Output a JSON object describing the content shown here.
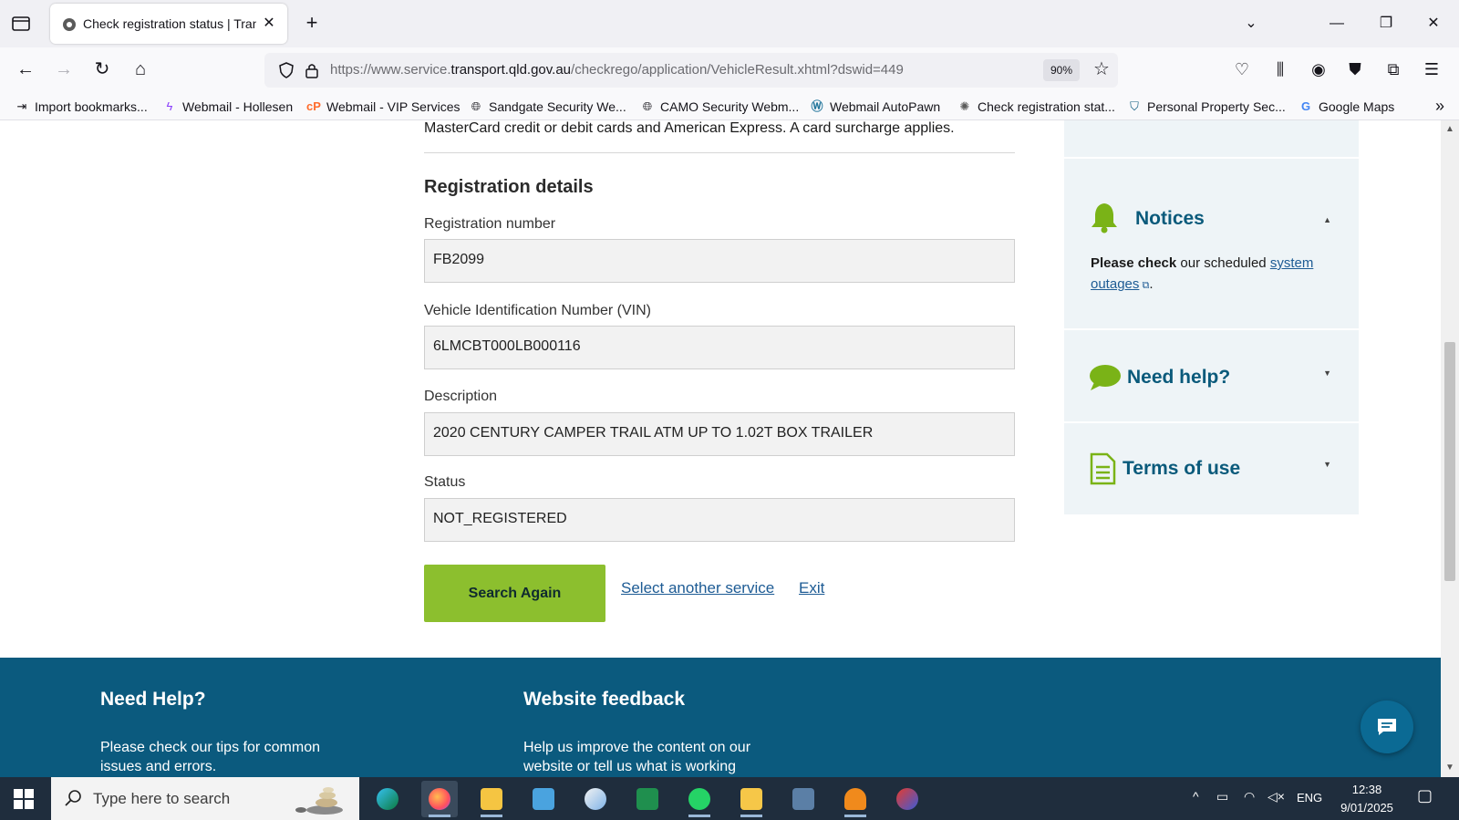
{
  "browser": {
    "tab_title": "Check registration status | Trans",
    "url_prefix": "https://www.service.",
    "url_domain": "transport.qld.gov.au",
    "url_path": "/checkrego/application/VehicleResult.xhtml?dswid=449",
    "zoom": "90%",
    "bookmarks": [
      {
        "label": "Import bookmarks...",
        "icon": "import-icon"
      },
      {
        "label": "Webmail - Hollesen",
        "icon": "lightning-icon"
      },
      {
        "label": "Webmail - VIP Services",
        "icon": "cp-icon"
      },
      {
        "label": "Sandgate Security We...",
        "icon": "globe-icon"
      },
      {
        "label": "CAMO Security Webm...",
        "icon": "globe-icon"
      },
      {
        "label": "Webmail AutoPawn",
        "icon": "wordpress-icon"
      },
      {
        "label": "Check registration stat...",
        "icon": "crest-icon"
      },
      {
        "label": "Personal Property Sec...",
        "icon": "shield-check-icon"
      },
      {
        "label": "Google Maps",
        "icon": "google-icon"
      }
    ]
  },
  "page": {
    "intro_text": "MasterCard credit or debit cards and American Express. A card surcharge applies.",
    "section_title": "Registration details",
    "fields": [
      {
        "label": "Registration number",
        "value": "FB2099"
      },
      {
        "label": "Vehicle Identification Number (VIN)",
        "value": "6LMCBT000LB000116"
      },
      {
        "label": "Description",
        "value": "2020 CENTURY CAMPER TRAIL ATM UP TO 1.02T BOX TRAILER"
      },
      {
        "label": "Status",
        "value": "NOT_REGISTERED"
      }
    ],
    "search_again_label": "Search Again",
    "select_service_label": "Select another service",
    "exit_label": "Exit"
  },
  "sidebar": {
    "notices_title": "Notices",
    "notice_bold": "Please check",
    "notice_text": " our scheduled ",
    "notice_link": "system outages",
    "notice_end": ".",
    "need_help_title": "Need help?",
    "terms_title": "Terms of use"
  },
  "footer": {
    "help_title": "Need Help?",
    "help_text": "Please check our tips for common issues and errors.",
    "feedback_title": "Website feedback",
    "feedback_text": "Help us improve the content on our website or tell us what is working"
  },
  "taskbar": {
    "search_placeholder": "Type here to search",
    "language": "ENG",
    "time": "12:38",
    "date": "9/01/2025",
    "apps": [
      "edge-icon",
      "firefox-icon",
      "file-explorer-icon",
      "control-panel-icon",
      "paint-icon",
      "excel-icon",
      "whatsapp-icon",
      "mail-icon",
      "calculator-icon",
      "app-icon",
      "snip-icon"
    ]
  },
  "colors": {
    "accent_green": "#8cbf2e",
    "link_blue": "#1d5b94",
    "heading_teal": "#0a5a7b",
    "footer_blue": "#0b5a7e",
    "notice_bell": "#7ab317"
  }
}
